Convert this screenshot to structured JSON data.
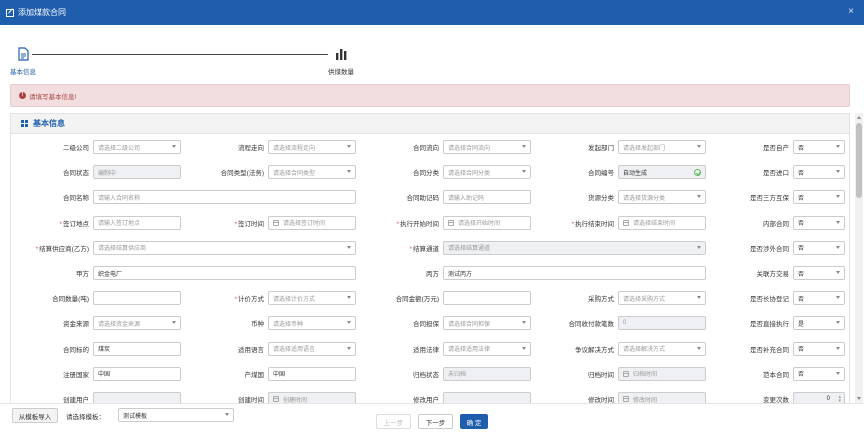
{
  "window": {
    "title": "添加煤款合同",
    "close_glyph": "×"
  },
  "steps": [
    {
      "label": "基本信息",
      "icon": "document-icon",
      "active": true
    },
    {
      "label": "供煤数量",
      "icon": "bar-chart-icon",
      "active": false
    }
  ],
  "alert": {
    "icon_glyph": "!",
    "text": "请填写基本信息!"
  },
  "panel": {
    "title": "基本信息"
  },
  "rows": [
    [
      {
        "label": "二级公司",
        "placeholder": "请选择二级公司",
        "type": "select"
      },
      {
        "label": "流程走向",
        "placeholder": "请选择流程走向",
        "type": "select"
      },
      {
        "label": "合同流向",
        "placeholder": "请选择合同流向",
        "type": "select"
      },
      {
        "label": "发起部门",
        "placeholder": "请选择发起部门",
        "type": "select"
      },
      {
        "label": "是否自产",
        "value": "否",
        "type": "select"
      }
    ],
    [
      {
        "label": "合同状态",
        "value": "编制中",
        "type": "disabled"
      },
      {
        "label": "合同类型(法务)",
        "placeholder": "请选择合同类型",
        "type": "select"
      },
      {
        "label": "合同分类",
        "placeholder": "请选择合同分类",
        "type": "select"
      },
      {
        "label": "合同编号",
        "value": "自动生成",
        "type": "disabled-check"
      },
      {
        "label": "是否进口",
        "value": "否",
        "type": "select"
      }
    ],
    [
      {
        "label": "合同名称",
        "placeholder": "请输入合同名称",
        "type": "text",
        "wide": true
      },
      {
        "label": "合同助记码",
        "placeholder": "请输入助记码",
        "type": "text"
      },
      {
        "label": "货源分类",
        "placeholder": "请选择货源分类",
        "type": "select"
      },
      {
        "label": "是否三方互保",
        "value": "否",
        "type": "select"
      }
    ],
    [
      {
        "label": "签订地点",
        "placeholder": "请输入签订地点",
        "type": "text",
        "required": true
      },
      {
        "label": "签订时间",
        "placeholder": "请选择签订时间",
        "type": "date",
        "required": true
      },
      {
        "label": "执行开始时间",
        "placeholder": "请选择开始时间",
        "type": "date",
        "required": true
      },
      {
        "label": "执行结束时间",
        "placeholder": "请选择结束时间",
        "type": "date",
        "required": true
      },
      {
        "label": "内部合同",
        "value": "否",
        "type": "select"
      }
    ],
    [
      {
        "label": "结算供应商(乙方)",
        "placeholder": "请选择结算供应商",
        "type": "select",
        "required": true,
        "wide": true
      },
      {
        "label": "结算通道",
        "placeholder": "请选择结算通道",
        "type": "select-disabled",
        "required": true,
        "wide": true
      },
      {
        "label": "是否涉外合同",
        "value": "否",
        "type": "select"
      }
    ],
    [
      {
        "label": "甲方",
        "value": "织金电厂",
        "type": "text",
        "wide": true
      },
      {
        "label": "丙方",
        "value": "测试丙方",
        "type": "text",
        "wide": true
      },
      {
        "label": "关联方交易",
        "value": "否",
        "type": "select"
      }
    ],
    [
      {
        "label": "合同数量(吨)",
        "value": "",
        "type": "text"
      },
      {
        "label": "计价方式",
        "placeholder": "请选择计价方式",
        "type": "select",
        "required": true
      },
      {
        "label": "合同金额(万元)",
        "value": "",
        "type": "text"
      },
      {
        "label": "采购方式",
        "placeholder": "请选择采购方式",
        "type": "select"
      },
      {
        "label": "是否长协登记",
        "value": "否",
        "type": "select"
      }
    ],
    [
      {
        "label": "资金来源",
        "placeholder": "请选择资金来源",
        "type": "select"
      },
      {
        "label": "币种",
        "placeholder": "请选择币种",
        "type": "select"
      },
      {
        "label": "合同担保",
        "placeholder": "请选择合同担保",
        "type": "select"
      },
      {
        "label": "合同收付款笔数",
        "value": "0",
        "type": "disabled"
      },
      {
        "label": "是否直接执行",
        "value": "是",
        "type": "select"
      }
    ],
    [
      {
        "label": "合同标的",
        "value": "煤炭",
        "type": "text"
      },
      {
        "label": "适用语言",
        "placeholder": "请选择适用语言",
        "type": "select"
      },
      {
        "label": "适用法律",
        "placeholder": "请选择适用法律",
        "type": "select"
      },
      {
        "label": "争议解决方式",
        "placeholder": "请选择解决方式",
        "type": "select"
      },
      {
        "label": "是否补充合同",
        "value": "否",
        "type": "select"
      }
    ],
    [
      {
        "label": "注册国家",
        "value": "中国",
        "type": "text"
      },
      {
        "label": "产煤国",
        "value": "中国",
        "type": "text"
      },
      {
        "label": "归档状态",
        "value": "未归档",
        "type": "disabled"
      },
      {
        "label": "归档时间",
        "placeholder": "归档时间",
        "type": "date-disabled"
      },
      {
        "label": "范本合同",
        "value": "否",
        "type": "select"
      }
    ],
    [
      {
        "label": "创建用户",
        "value": "",
        "type": "disabled"
      },
      {
        "label": "创建时间",
        "placeholder": "创建时间",
        "type": "date-disabled"
      },
      {
        "label": "修改用户",
        "value": "",
        "type": "disabled"
      },
      {
        "label": "修改时间",
        "placeholder": "修改时间",
        "type": "date-disabled"
      },
      {
        "label": "变更次数",
        "value": "0",
        "type": "spin"
      }
    ]
  ],
  "bottom": {
    "import_label": "从模板导入",
    "template_label": "请选择模板：",
    "template_value": "测试模板",
    "prev_label": "上一步",
    "next_label": "下一步",
    "ok_label": "确 定"
  }
}
